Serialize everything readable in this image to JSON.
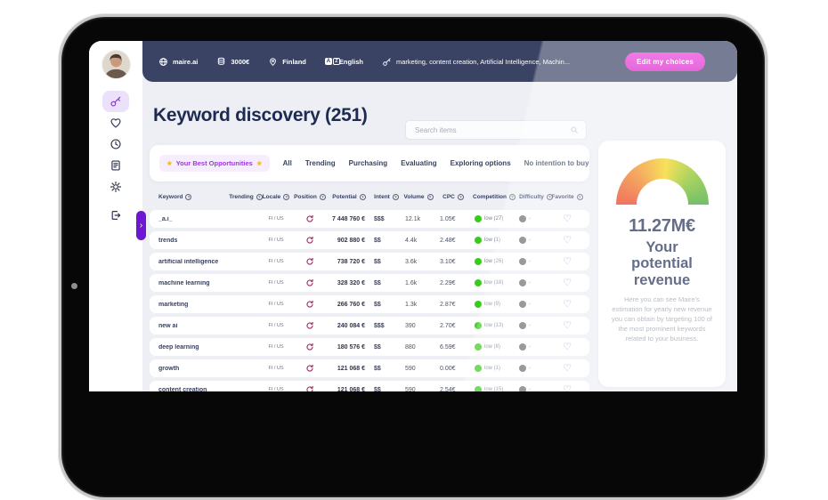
{
  "topbar": {
    "items": [
      {
        "icon": "globe-icon",
        "name": "site",
        "label": "maire.ai"
      },
      {
        "icon": "coins-icon",
        "name": "budget",
        "label": "3000€"
      },
      {
        "icon": "pin-icon",
        "name": "country",
        "label": "Finland"
      },
      {
        "icon": "translate-icon",
        "name": "language",
        "label": "English"
      },
      {
        "icon": "key-icon",
        "name": "keywords",
        "label": "marketing, content creation, Artificial Intelligence, Machin..."
      }
    ],
    "edit_button": "Edit my choices",
    "button_color": "#e02ed3"
  },
  "sidebar": {
    "items": [
      {
        "icon": "key-icon",
        "name": "keyword-discovery",
        "active": true
      },
      {
        "icon": "heart-icon",
        "name": "favorites",
        "active": false
      },
      {
        "icon": "clock-icon",
        "name": "history",
        "active": false
      },
      {
        "icon": "report-icon",
        "name": "reports",
        "active": false
      },
      {
        "icon": "gear-icon",
        "name": "settings",
        "active": false
      },
      {
        "icon": "logout-icon",
        "name": "logout",
        "active": false
      }
    ],
    "collapse_chevron": "›"
  },
  "main": {
    "title": "Keyword discovery (251)",
    "search_placeholder": "Search items"
  },
  "filters": {
    "best": {
      "star": "★",
      "label": "Your Best Opportunities"
    },
    "tabs": [
      "All",
      "Trending",
      "Purchasing",
      "Evaluating",
      "Exploring options",
      "No intention to buy"
    ]
  },
  "table": {
    "columns": [
      "Keyword",
      "Trending",
      "Locale",
      "Position",
      "Potential",
      "Intent",
      "Volume",
      "CPC",
      "Competition",
      "Difficulty",
      "Favorite"
    ],
    "icons": {
      "position": "refresh-icon",
      "favorite": "heart-icon",
      "help": "help-icon"
    },
    "competition_color": "#35cc1c",
    "difficulty_color": "#6e6e6e",
    "favorite_glyph": "♡",
    "help_glyph": "?",
    "rows": [
      {
        "keyword": "_a.i_",
        "locale": "FI / US",
        "potential": "7 448 760 €",
        "intent": "$$$",
        "volume": "12.1k",
        "cpc": "1.05€",
        "competition": "low (27)",
        "difficulty": "-"
      },
      {
        "keyword": "trends",
        "locale": "FI / US",
        "potential": "902 880 €",
        "intent": "$$",
        "volume": "4.4k",
        "cpc": "2.48€",
        "competition": "low (1)",
        "difficulty": "-"
      },
      {
        "keyword": "artificial intelligence",
        "locale": "FI / US",
        "potential": "738 720 €",
        "intent": "$$",
        "volume": "3.6k",
        "cpc": "3.10€",
        "competition": "low (26)",
        "difficulty": "-"
      },
      {
        "keyword": "machine learning",
        "locale": "FI / US",
        "potential": "328 320 €",
        "intent": "$$",
        "volume": "1.6k",
        "cpc": "2.29€",
        "competition": "low (18)",
        "difficulty": "-"
      },
      {
        "keyword": "marketing",
        "locale": "FI / US",
        "potential": "266 760 €",
        "intent": "$$",
        "volume": "1.3k",
        "cpc": "2.87€",
        "competition": "low (9)",
        "difficulty": "-"
      },
      {
        "keyword": "new ai",
        "locale": "FI / US",
        "potential": "240 084 €",
        "intent": "$$$",
        "volume": "390",
        "cpc": "2.70€",
        "competition": "low (13)",
        "difficulty": "-"
      },
      {
        "keyword": "deep learning",
        "locale": "FI / US",
        "potential": "180 576 €",
        "intent": "$$",
        "volume": "880",
        "cpc": "6.59€",
        "competition": "low (8)",
        "difficulty": "-"
      },
      {
        "keyword": "growth",
        "locale": "FI / US",
        "potential": "121 068 €",
        "intent": "$$",
        "volume": "590",
        "cpc": "0.00€",
        "competition": "low (1)",
        "difficulty": "-"
      },
      {
        "keyword": "content creation",
        "locale": "FI / US",
        "potential": "121 068 €",
        "intent": "$$",
        "volume": "590",
        "cpc": "2.54€",
        "competition": "low (15)",
        "difficulty": "-"
      }
    ]
  },
  "panel": {
    "value": "11.27M€",
    "heading": "Your potential revenue",
    "description": "Here you can see Maire's estimation for yearly new revenue you can obtain by targeting 100 of the most prominent keywords related to your business.",
    "gauge_colors": [
      "#e8391c",
      "#f0821c",
      "#f4d313",
      "#86c11c",
      "#35a32a"
    ]
  }
}
